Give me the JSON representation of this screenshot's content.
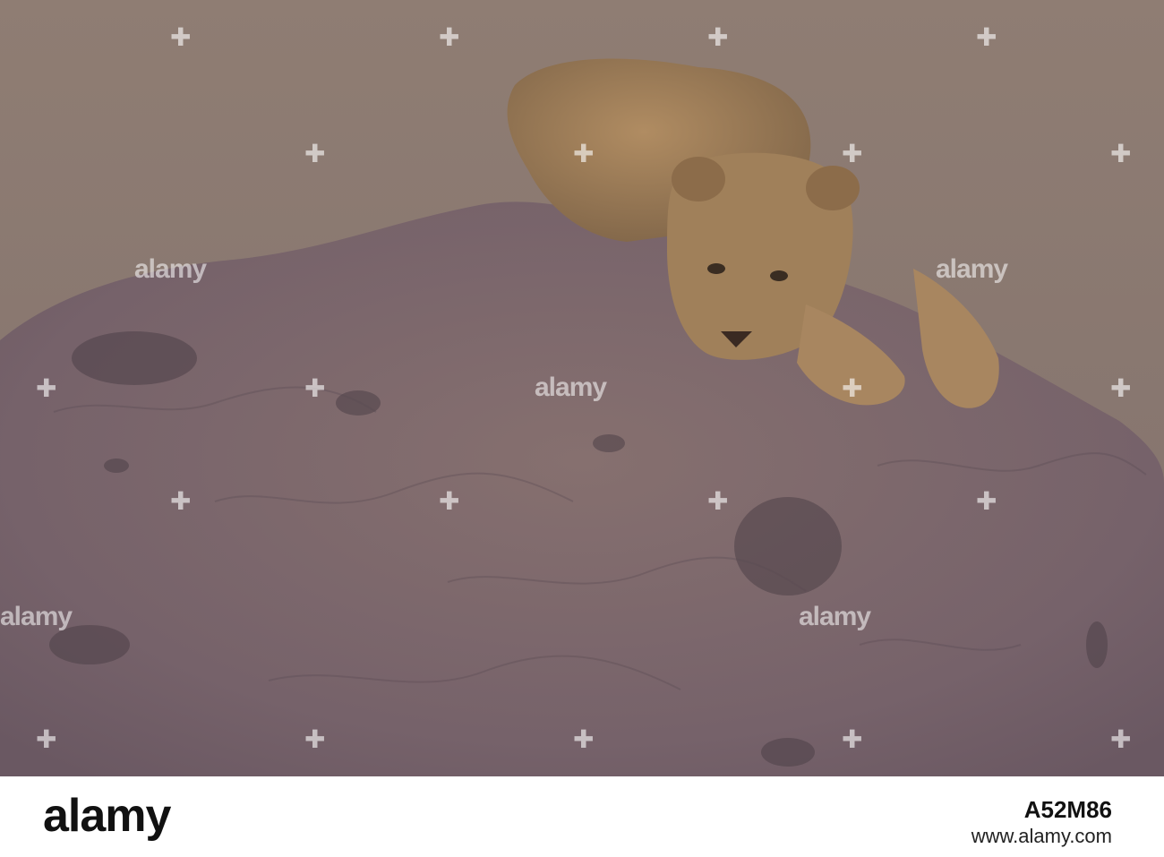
{
  "photo": {
    "subject": "lion-cub-on-termite-mound",
    "colors": {
      "background": "#8c7a72",
      "mound": "#7d6a6b",
      "lion": "#9a7a55"
    }
  },
  "watermark": {
    "text": "alamy"
  },
  "footer": {
    "brand": "alamy",
    "image_id": "A52M86",
    "url": "www.alamy.com"
  }
}
